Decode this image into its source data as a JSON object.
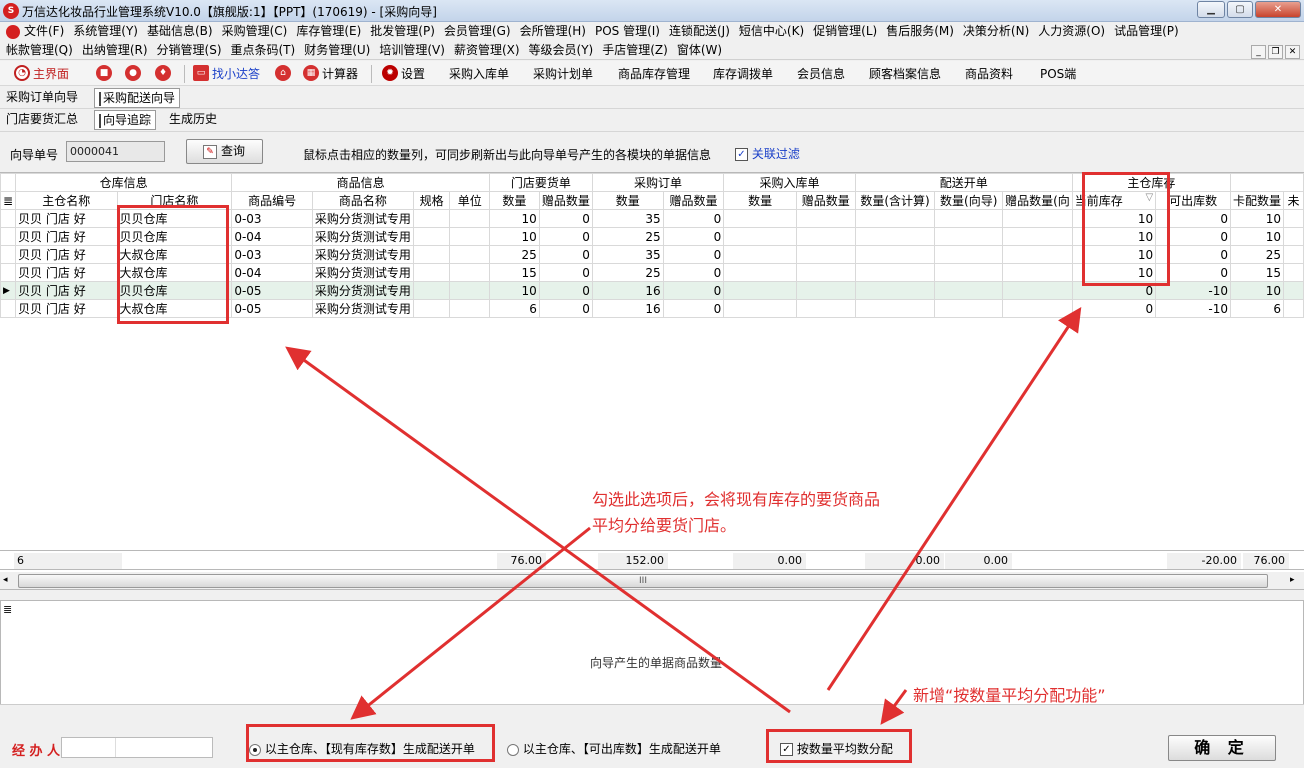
{
  "title": "万信达化妆品行业管理系统V10.0【旗舰版:1】【PPT】(170619) - [采购向导]",
  "app_icon_text": "S",
  "menu_row1": [
    "文件(F)",
    "系统管理(Y)",
    "基础信息(B)",
    "采购管理(C)",
    "库存管理(E)",
    "批发管理(P)",
    "会员管理(G)",
    "会所管理(H)",
    "POS 管理(I)",
    "连锁配送(J)",
    "短信中心(K)",
    "促销管理(L)",
    "售后服务(M)",
    "决策分析(N)",
    "人力资源(O)",
    "试品管理(P)"
  ],
  "menu_row2": [
    "帐款管理(Q)",
    "出纳管理(R)",
    "分销管理(S)",
    "重点条码(T)",
    "财务管理(U)",
    "培训管理(V)",
    "薪资管理(X)",
    "等级会员(Y)",
    "手店管理(Z)",
    "窗体(W)"
  ],
  "toolbar": {
    "home": "主界面",
    "xiaoda": "找小达答",
    "calculator": "计算器",
    "settings": "设置",
    "items": [
      "采购入库单",
      "采购计划单",
      "商品库存管理",
      "库存调拨单",
      "会员信息",
      "顾客档案信息",
      "商品资料",
      "POS端"
    ]
  },
  "tabs_row1": [
    "采购订单向导",
    "采购配送向导"
  ],
  "tabs_row2": [
    "门店要货汇总",
    "向导追踪",
    "生成历史"
  ],
  "query": {
    "label": "向导单号",
    "value": "0000041",
    "button": "查询",
    "hint": "鼠标点击相应的数量列，可同步刷新出与此向导单号产生的各模块的单据信息",
    "filter_label": "关联过滤",
    "filter_check": "✓"
  },
  "grid": {
    "groups": [
      "仓库信息",
      "商品信息",
      "门店要货单",
      "采购订单",
      "采购入库单",
      "配送开单",
      "主仓库存"
    ],
    "columns": [
      "主仓名称",
      "门店名称",
      "商品编号",
      "商品名称",
      "规格",
      "单位",
      "数量",
      "赠品数量",
      "数量",
      "赠品数量",
      "数量",
      "赠品数量",
      "数量(含计算)",
      "数量(向导)",
      "赠品数量(向",
      "当前库存",
      "可出库数",
      "卡配数量",
      "未"
    ],
    "sort_indicator": "▽",
    "rows": [
      [
        "贝贝 门店 好",
        "贝贝仓库",
        "0-03",
        "采购分货测试专用",
        "",
        "",
        "10",
        "0",
        "35",
        "0",
        "",
        "",
        "",
        "",
        "",
        "10",
        "0",
        "10",
        ""
      ],
      [
        "贝贝 门店 好",
        "贝贝仓库",
        "0-04",
        "采购分货测试专用",
        "",
        "",
        "10",
        "0",
        "25",
        "0",
        "",
        "",
        "",
        "",
        "",
        "10",
        "0",
        "10",
        ""
      ],
      [
        "贝贝 门店 好",
        "大叔仓库",
        "0-03",
        "采购分货测试专用",
        "",
        "",
        "25",
        "0",
        "35",
        "0",
        "",
        "",
        "",
        "",
        "",
        "10",
        "0",
        "25",
        ""
      ],
      [
        "贝贝 门店 好",
        "大叔仓库",
        "0-04",
        "采购分货测试专用",
        "",
        "",
        "15",
        "0",
        "25",
        "0",
        "",
        "",
        "",
        "",
        "",
        "10",
        "0",
        "15",
        ""
      ],
      [
        "贝贝 门店 好",
        "贝贝仓库",
        "0-05",
        "采购分货测试专用",
        "",
        "",
        "10",
        "0",
        "16",
        "0",
        "",
        "",
        "",
        "",
        "",
        "0",
        "-10",
        "10",
        ""
      ],
      [
        "贝贝 门店 好",
        "大叔仓库",
        "0-05",
        "采购分货测试专用",
        "",
        "",
        "6",
        "0",
        "16",
        "0",
        "",
        "",
        "",
        "",
        "",
        "0",
        "-10",
        "6",
        ""
      ]
    ],
    "row_indicator": "▶",
    "footer": {
      "count": "6",
      "qty": "76.00",
      "order_qty": "152.00",
      "in_qty": "0.00",
      "dist1": "0.00",
      "dist2": "0.00",
      "avail": "-20.00",
      "last": "76.00"
    },
    "scroll_grip": "III"
  },
  "lower_caption": "向导产生的单据商品数量",
  "bottom": {
    "handler_label": "经 办 人",
    "option1": "以主仓库、【现有库存数】生成配送开单",
    "option2": "以主仓库、【可出库数】生成配送开单",
    "avg_label": "按数量平均数分配",
    "avg_check": "✓",
    "confirm": "确 定"
  },
  "annotations": {
    "note1_line1": "勾选此选项后，会将现有库存的要货商品",
    "note1_line2": "平均分给要货门店。",
    "note2": "新增“按数量平均分配功能”"
  },
  "colors": {
    "annotation": "#e03030",
    "link": "#1a3fc8",
    "selected_row": "#e6f2ea"
  }
}
